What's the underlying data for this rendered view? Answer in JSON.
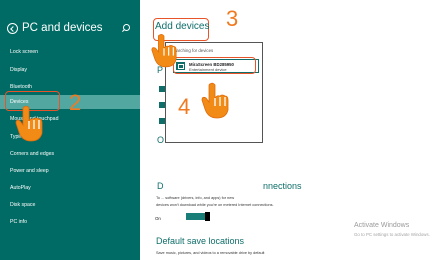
{
  "sidebar": {
    "title": "PC and devices",
    "items": [
      {
        "label": "Lock screen"
      },
      {
        "label": "Display"
      },
      {
        "label": "Bluetooth"
      },
      {
        "label": "Devices"
      },
      {
        "label": "Mouse and touchpad"
      },
      {
        "label": "Typing"
      },
      {
        "label": "Corners and edges"
      },
      {
        "label": "Power and sleep"
      },
      {
        "label": "AutoPlay"
      },
      {
        "label": "Disk space"
      },
      {
        "label": "PC info"
      }
    ],
    "active_item": "Devices"
  },
  "main": {
    "title": "Add devices",
    "searching_text": "Searching for devices",
    "section_p": "P",
    "section_o": "O",
    "section_d_left": "D",
    "section_d_right": "nnections",
    "download_desc_1": "To ... software (drivers, info, and apps) for new",
    "download_desc_2": "devices won't download while you're on metered Internet connections.",
    "toggle_label": "On",
    "default_save_title": "Default save locations",
    "default_save_desc": "Save music, pictures, and videos to a removable drive by default"
  },
  "popup": {
    "device_name": "MiraScreen BD285950",
    "device_type": "Entertainment device"
  },
  "steps": [
    "2",
    "3",
    "4"
  ],
  "watermark": {
    "title": "Activate Windows",
    "subtitle": "Go to PC settings to activate Windows."
  },
  "colors": {
    "sidebar_bg": "#006b64",
    "sidebar_active": "#53a7a1",
    "accent": "#0f6e6a",
    "annotation_orange": "#f07a20",
    "highlight_red": "#e8542a"
  }
}
